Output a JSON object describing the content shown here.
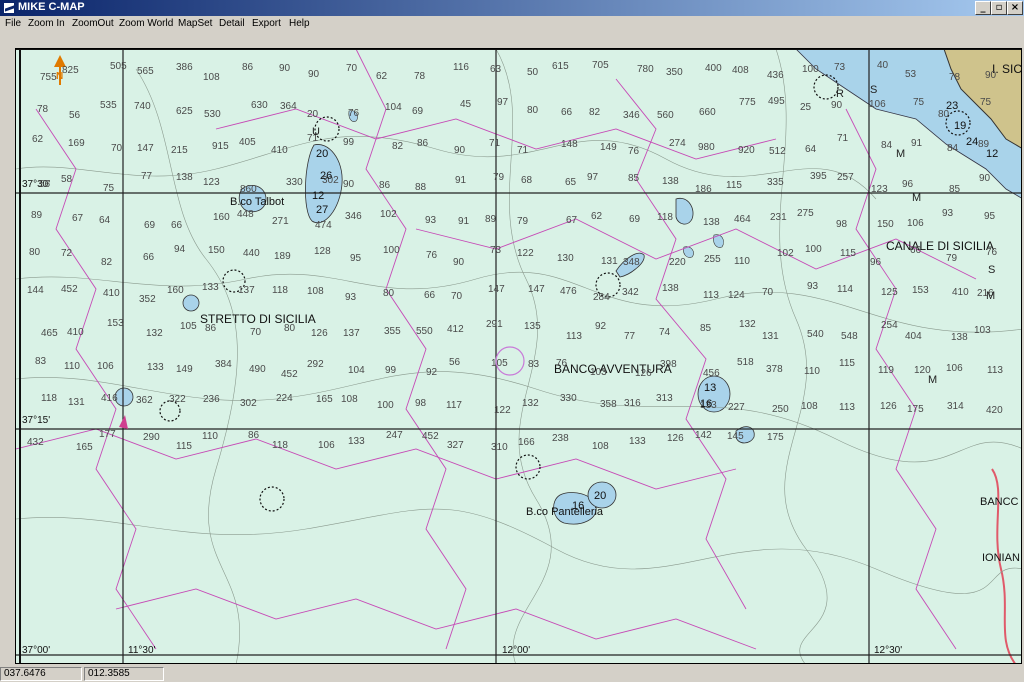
{
  "window": {
    "title": "MIKE C-MAP",
    "buttons": [
      "_",
      "▫",
      "×"
    ]
  },
  "menu": [
    "File",
    "Zoom In",
    "ZoomOut",
    "Zoom World",
    "MapSet",
    "Detail",
    "Export",
    "Help"
  ],
  "chart": {
    "place_names": {
      "stretto": "STRETTO DI SICILIA",
      "canale": "CANALE DI SICILIA",
      "avventura": "BANCO AVVENTURA",
      "talbot": "B.co Talbot",
      "pantelleria": "B.co Pantelleria",
      "isic": "I. SIC",
      "bancc": "BANCC",
      "ionian": "IONIAN"
    },
    "latitude_labels": [
      "37°30'",
      "37°15'",
      "37°00'"
    ],
    "longitude_labels": [
      "11°30'",
      "12°00'",
      "12°30'"
    ],
    "north_arrow": "N",
    "depths": [
      "755",
      "825",
      "505",
      "565",
      "386",
      "108",
      "86",
      "90",
      "90",
      "70",
      "62",
      "78",
      "116",
      "63",
      "50",
      "615",
      "705",
      "780",
      "350",
      "400",
      "408",
      "436",
      "100",
      "73",
      "40",
      "53",
      "78",
      "90",
      "78",
      "56",
      "535",
      "740",
      "625",
      "530",
      "630",
      "364",
      "20",
      "76",
      "104",
      "69",
      "45",
      "97",
      "80",
      "66",
      "82",
      "346",
      "560",
      "660",
      "775",
      "495",
      "25",
      "90",
      "106",
      "75",
      "80",
      "75",
      "62",
      "169",
      "70",
      "147",
      "215",
      "915",
      "405",
      "410",
      "71",
      "99",
      "82",
      "86",
      "90",
      "71",
      "71",
      "148",
      "149",
      "76",
      "274",
      "980",
      "920",
      "512",
      "64",
      "71",
      "84",
      "91",
      "84",
      "89",
      "56",
      "58",
      "75",
      "77",
      "138",
      "123",
      "860",
      "330",
      "302",
      "90",
      "86",
      "88",
      "91",
      "79",
      "68",
      "65",
      "97",
      "85",
      "138",
      "186",
      "115",
      "335",
      "395",
      "257",
      "123",
      "96",
      "85",
      "90",
      "89",
      "67",
      "64",
      "69",
      "66",
      "160",
      "448",
      "271",
      "474",
      "346",
      "102",
      "93",
      "91",
      "89",
      "79",
      "67",
      "62",
      "69",
      "118",
      "138",
      "464",
      "231",
      "275",
      "98",
      "150",
      "106",
      "93",
      "95",
      "80",
      "72",
      "82",
      "66",
      "94",
      "150",
      "440",
      "189",
      "128",
      "95",
      "100",
      "76",
      "90",
      "73",
      "122",
      "130",
      "131",
      "348",
      "220",
      "255",
      "110",
      "102",
      "100",
      "115",
      "96",
      "66",
      "79",
      "76",
      "144",
      "452",
      "410",
      "352",
      "160",
      "133",
      "137",
      "118",
      "108",
      "93",
      "80",
      "66",
      "70",
      "147",
      "147",
      "476",
      "284",
      "342",
      "138",
      "113",
      "124",
      "70",
      "93",
      "114",
      "125",
      "153",
      "410",
      "216",
      "465",
      "410",
      "153",
      "132",
      "105",
      "86",
      "70",
      "80",
      "126",
      "137",
      "355",
      "550",
      "412",
      "291",
      "135",
      "113",
      "92",
      "77",
      "74",
      "85",
      "132",
      "131",
      "540",
      "548",
      "254",
      "404",
      "138",
      "103",
      "83",
      "110",
      "106",
      "133",
      "149",
      "384",
      "490",
      "452",
      "292",
      "104",
      "99",
      "92",
      "56",
      "105",
      "83",
      "76",
      "103",
      "126",
      "398",
      "456",
      "518",
      "378",
      "110",
      "115",
      "119",
      "120",
      "106",
      "113",
      "118",
      "131",
      "416",
      "362",
      "322",
      "236",
      "302",
      "224",
      "165",
      "108",
      "100",
      "98",
      "117",
      "122",
      "132",
      "330",
      "358",
      "316",
      "313",
      "133",
      "227",
      "250",
      "108",
      "113",
      "126",
      "175",
      "314",
      "420",
      "432",
      "165",
      "177",
      "290",
      "115",
      "110",
      "86",
      "118",
      "106",
      "133",
      "247",
      "452",
      "327",
      "310",
      "166",
      "238",
      "108",
      "133",
      "126",
      "142",
      "145",
      "175"
    ],
    "shoal_values": [
      "20",
      "26",
      "12",
      "27",
      "13",
      "16",
      "20",
      "16",
      "19",
      "23",
      "24",
      "12"
    ],
    "area_codes": [
      "U",
      "R",
      "S",
      "M",
      "M",
      "M",
      "S",
      "M"
    ]
  },
  "status": {
    "latitude": "037.6476",
    "longitude": "012.3585"
  }
}
